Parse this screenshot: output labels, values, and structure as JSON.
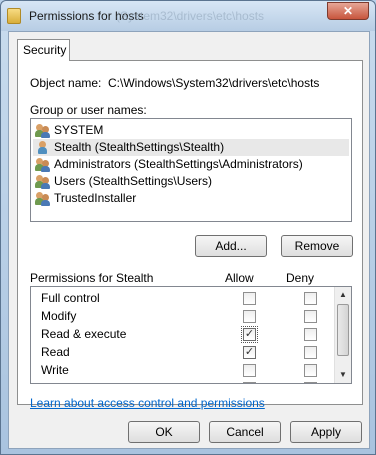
{
  "window": {
    "title": "Permissions for hosts",
    "background_title_ghost": "(System32\\drivers\\etc\\hosts",
    "close_label": "✕"
  },
  "tabs": [
    {
      "label": "Security",
      "active": true
    }
  ],
  "object": {
    "label": "Object name:",
    "value": "C:\\Windows\\System32\\drivers\\etc\\hosts"
  },
  "groups": {
    "label": "Group or user names:",
    "items": [
      {
        "name": "SYSTEM",
        "icon": "user-group-icon",
        "selected": false
      },
      {
        "name": "Stealth (StealthSettings\\Stealth)",
        "icon": "user-icon",
        "selected": true
      },
      {
        "name": "Administrators (StealthSettings\\Administrators)",
        "icon": "user-group-icon",
        "selected": false
      },
      {
        "name": "Users (StealthSettings\\Users)",
        "icon": "user-group-icon",
        "selected": false
      },
      {
        "name": "TrustedInstaller",
        "icon": "user-group-icon",
        "selected": false
      }
    ],
    "add_label": "Add...",
    "remove_label": "Remove"
  },
  "permissions": {
    "label": "Permissions for Stealth",
    "allow_header": "Allow",
    "deny_header": "Deny",
    "rows": [
      {
        "name": "Full control",
        "allow": false,
        "deny": false
      },
      {
        "name": "Modify",
        "allow": false,
        "deny": false
      },
      {
        "name": "Read & execute",
        "allow": true,
        "deny": false
      },
      {
        "name": "Read",
        "allow": true,
        "deny": false
      },
      {
        "name": "Write",
        "allow": false,
        "deny": false
      }
    ],
    "check_glyph": "✓",
    "scroll_up_glyph": "▲",
    "scroll_down_glyph": "▼"
  },
  "link": {
    "text": "Learn about access control and permissions"
  },
  "footer": {
    "ok_label": "OK",
    "cancel_label": "Cancel",
    "apply_label": "Apply"
  },
  "colors": {
    "link": "#0066cc",
    "selection": "#e8e8e8",
    "frame": "#b9d1ea"
  }
}
